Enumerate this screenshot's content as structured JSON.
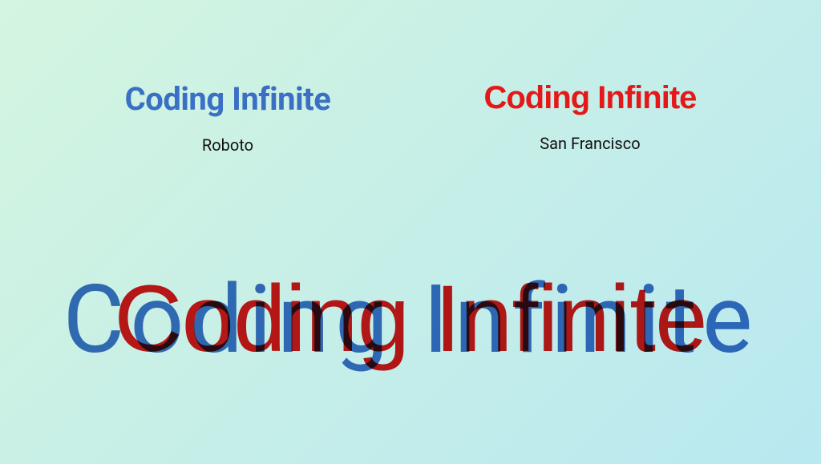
{
  "samples": {
    "left": {
      "heading": "Coding Infinite",
      "label": "Roboto"
    },
    "right": {
      "heading": "Coding Infinite",
      "label": "San Francisco"
    }
  },
  "overlay": {
    "blue": "Coding Infinite",
    "red": "Coding Infinite"
  },
  "colors": {
    "blue": "#3b6fc4",
    "red": "#e41818"
  }
}
